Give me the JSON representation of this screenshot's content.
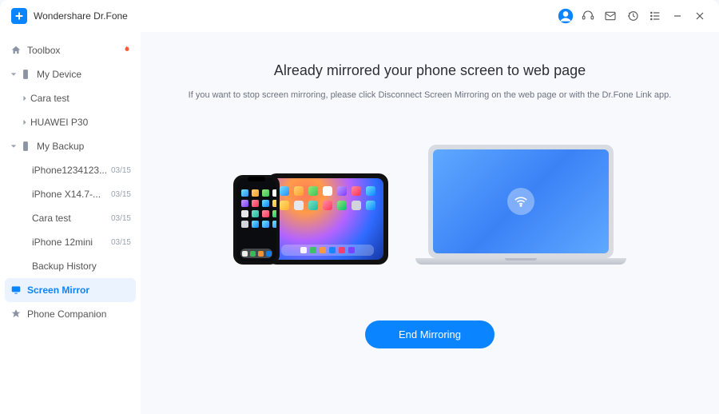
{
  "app": {
    "title": "Wondershare Dr.Fone"
  },
  "titlebar_icons": {
    "avatar": "avatar",
    "headset": "headset",
    "mail": "mail",
    "history": "history",
    "menu": "menu",
    "minimize": "minimize",
    "close": "close"
  },
  "sidebar": {
    "toolbox": "Toolbox",
    "my_device": "My Device",
    "device_items": [
      {
        "label": "Cara test"
      },
      {
        "label": "HUAWEI P30"
      }
    ],
    "my_backup": "My Backup",
    "backup_items": [
      {
        "label": "iPhone1234123...",
        "date": "03/15"
      },
      {
        "label": "iPhone X14.7-...",
        "date": "03/15"
      },
      {
        "label": "Cara test",
        "date": "03/15"
      },
      {
        "label": "iPhone 12mini",
        "date": "03/15"
      }
    ],
    "backup_history": "Backup History",
    "screen_mirror": "Screen Mirror",
    "phone_companion": "Phone Companion"
  },
  "main": {
    "heading": "Already mirrored your phone screen to web page",
    "subtext": "If you want to stop screen mirroring, please click Disconnect Screen Mirroring on the web page or with the Dr.Fone Link app.",
    "button": "End Mirroring"
  }
}
